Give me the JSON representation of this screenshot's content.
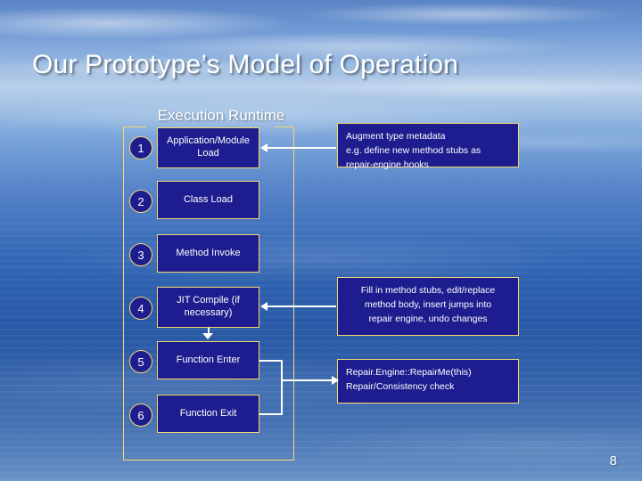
{
  "slide": {
    "title": "Our Prototype’s Model of Operation",
    "page_number": "8",
    "accent_border": "#f5d76e",
    "box_fill": "#1d1d8f",
    "arrow_color": "#ffffff"
  },
  "runtime": {
    "label": "Execution Runtime",
    "steps": [
      {
        "num": "1",
        "label": "Application/Module Load"
      },
      {
        "num": "2",
        "label": "Class Load"
      },
      {
        "num": "3",
        "label": "Method Invoke"
      },
      {
        "num": "4",
        "label": "JIT Compile (if necessary)"
      },
      {
        "num": "5",
        "label": "Function Enter"
      },
      {
        "num": "6",
        "label": "Function Exit"
      }
    ]
  },
  "notes": [
    {
      "id": "note-augment",
      "lines": [
        "Augment type metadata",
        "e.g. define new method stubs as",
        "repair-engine hooks"
      ]
    },
    {
      "id": "note-fill-stubs",
      "lines": [
        "Fill in method stubs, edit/replace",
        "method body, insert jumps into",
        "repair engine, undo changes"
      ]
    },
    {
      "id": "note-repair-engine",
      "lines": [
        "Repair.Engine::RepairMe(this)",
        "Repair/Consistency check"
      ]
    }
  ]
}
